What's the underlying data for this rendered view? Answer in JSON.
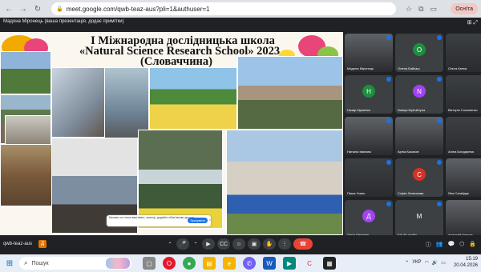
{
  "browser": {
    "url": "meet.google.com/qwb-teaz-aus?pli=1&authuser=1",
    "profile": "Оснїта",
    "lock_icon": "lock-icon"
  },
  "meet": {
    "presenter_label": "Мадона Міронець (ваша презентація, додає примітки)",
    "meeting_code": "qwb-teaz-aus",
    "code_badge": "Д"
  },
  "slide": {
    "title_line1": "І Міжнародна дослідницька школа",
    "title_line2": "«Natural Science Research School» 2023",
    "title_line3": "(Словаччина)",
    "notice_text": "Бачимо чи тільки ваш вміст, заштор, додайте обов'язково доступ...",
    "notice_button": "Зрозуміло",
    "notice_close": "×"
  },
  "participants": [
    {
      "name": "Мадона Міронець",
      "color": "#5f6368",
      "initial": ""
    },
    {
      "name": "Олена Байкаш",
      "color": "#1e8e3e",
      "initial": "О"
    },
    {
      "name": "Ольга Катюк",
      "color": "#3c4043",
      "initial": ""
    },
    {
      "name": "Назар Кірменко",
      "color": "#1e8e3e",
      "initial": "Н"
    },
    {
      "name": "Nastya Mytrokhyna",
      "color": "#a142f4",
      "initial": "N"
    },
    {
      "name": "Вікторія Соломенко",
      "color": "#3c4043",
      "initial": ""
    },
    {
      "name": "Наталія Іванова",
      "color": "#5f6368",
      "initial": ""
    },
    {
      "name": "Арніа Касачов",
      "color": "#5f6368",
      "initial": ""
    },
    {
      "name": "Аліна Бондарева",
      "color": "#3c4043",
      "initial": ""
    },
    {
      "name": "Паша Усань",
      "color": "#3c4043",
      "initial": ""
    },
    {
      "name": "Софія Литвинова",
      "color": "#d93025",
      "initial": "С"
    },
    {
      "name": "Яна Сагайдак",
      "color": "#5f6368",
      "initial": ""
    },
    {
      "name": "Дар'я Пелкова",
      "color": "#a142f4",
      "initial": "Д"
    },
    {
      "name": "Ще 34 особи",
      "color": "#3c4043",
      "initial": "М"
    },
    {
      "name": "Анатолій Каркон",
      "color": "#5f6368",
      "initial": ""
    }
  ],
  "controls": {
    "mic_icon": "mic-icon",
    "camera_icon": "camera-icon",
    "captions_icon": "captions-icon",
    "emoji_icon": "emoji-icon",
    "present_icon": "present-icon",
    "hand_icon": "raise-hand-icon",
    "more_icon": "more-icon",
    "end_call_icon": "end-call-icon"
  },
  "taskbar": {
    "search_placeholder": "Пошук",
    "language": "УКР",
    "time": "15:19",
    "date": "20.04.2026"
  }
}
